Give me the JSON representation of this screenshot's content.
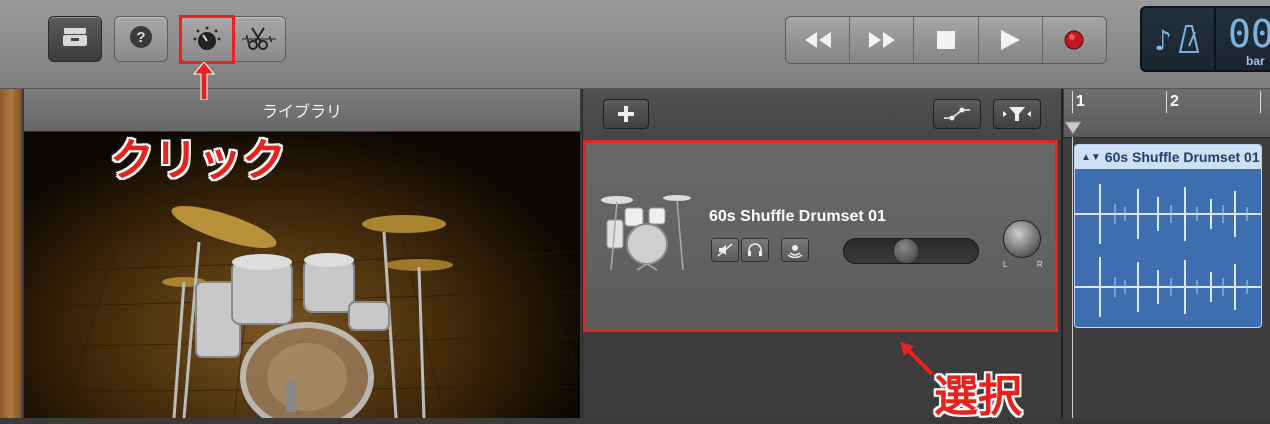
{
  "toolbar": {
    "library_icon": "library-tray-icon",
    "help_icon": "question-mark-icon",
    "smart_controls_icon": "knob-icon",
    "editor_icon": "scissors-icon",
    "transport": {
      "rewind_icon": "rewind-icon",
      "forward_icon": "fast-forward-icon",
      "stop_icon": "stop-icon",
      "play_icon": "play-icon",
      "record_icon": "record-icon"
    },
    "lcd": {
      "bar_label": "bar",
      "digits": "00",
      "metronome_icon": "metronome-icon"
    }
  },
  "library": {
    "title": "ライブラリ"
  },
  "tracks": {
    "add_icon": "plus-icon",
    "automation_icon": "automation-icon",
    "filter_icon": "filter-icon",
    "track": {
      "name": "60s Shuffle Drumset 01",
      "mute_icon": "mute-icon",
      "headphones_icon": "headphones-icon",
      "input_icon": "input-monitor-icon",
      "pan_left": "L",
      "pan_right": "R",
      "volume": 0.45
    }
  },
  "ruler": {
    "marks": [
      "1",
      "2"
    ]
  },
  "region": {
    "title": "60s Shuffle Drumset 01"
  },
  "annotations": {
    "click_label": "クリック",
    "select_label": "選択"
  },
  "colors": {
    "highlight": "#e8231d",
    "region": "#3e6db0"
  }
}
